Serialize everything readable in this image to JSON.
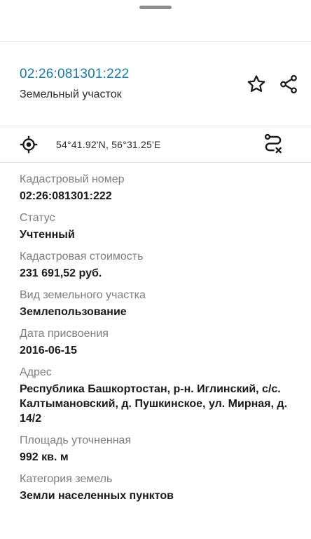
{
  "header": {
    "cadastral_number": "02:26:081301:222",
    "subtitle": "Земельный участок"
  },
  "icons": {
    "favorite": "star-icon",
    "share": "share-icon",
    "location": "crosshair-icon",
    "route": "route-icon"
  },
  "location": {
    "coords": "54°41.92'N, 56°31.25'E"
  },
  "fields": [
    {
      "label": "Кадастровый номер",
      "value": "02:26:081301:222"
    },
    {
      "label": "Статус",
      "value": "Учтенный"
    },
    {
      "label": "Кадастровая стоимость",
      "value": "231 691,52 руб."
    },
    {
      "label": "Вид земельного участка",
      "value": "Землепользование"
    },
    {
      "label": "Дата присвоения",
      "value": "2016-06-15"
    },
    {
      "label": "Адрес",
      "value": "Республика Башкортостан, р-н. Иглинский, с/с. Калтымановский, д. Пушкинское, ул. Мирная, д. 14/2"
    },
    {
      "label": "Площадь уточненная",
      "value": "992 кв. м"
    },
    {
      "label": "Категория земель",
      "value": "Земли населенных пунктов"
    }
  ],
  "colors": {
    "link": "#1f7aa0",
    "label": "#7d7d7d",
    "divider": "#e2e2e2"
  }
}
